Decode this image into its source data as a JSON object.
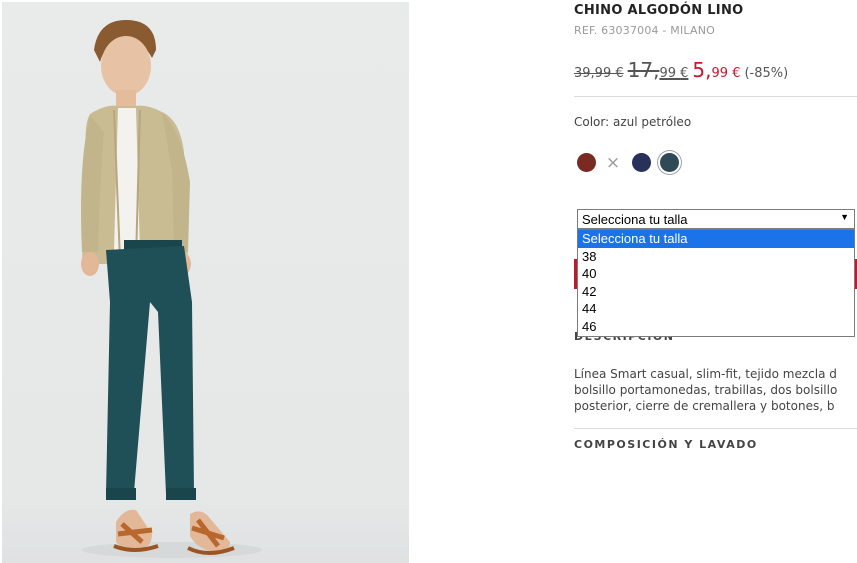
{
  "product": {
    "title": "CHINO ALGODÓN LINO",
    "ref": "REF. 63037004 - MILANO",
    "price_original": "39,99 €",
    "price_mid_int": "17,",
    "price_mid_dec": "99",
    "price_mid_cur": "€",
    "price_new_int": "5,",
    "price_new_dec": "99",
    "price_new_cur": "€",
    "discount": "(-85%)",
    "color_label": "Color: azul petróleo"
  },
  "swatches": [
    {
      "name": "granate",
      "color": "#7a2a22"
    },
    {
      "name": "unavailable",
      "symbol": "×"
    },
    {
      "name": "azul-marino",
      "color": "#27315a"
    },
    {
      "name": "azul-petroleo",
      "color": "#2f4a56",
      "selected": true
    }
  ],
  "size_select": {
    "value": "Selecciona tu talla",
    "options": [
      "Selecciona tu talla",
      "38",
      "40",
      "42",
      "44",
      "46"
    ],
    "highlighted": 0
  },
  "description": {
    "heading": "DESCRIPCIÓN",
    "lines": [
      "Línea Smart casual, slim-fit, tejido mezcla d",
      "bolsillo portamonedas, trabillas, dos bolsillo",
      "posterior, cierre de cremallera y botones, b"
    ]
  },
  "composition_heading": "COMPOSICIÓN Y LAVADO",
  "colors": {
    "sale_red": "#c5172b",
    "highlight_blue": "#1a73e8",
    "pants_teal": "#1f4f57",
    "cardigan_beige": "#c9bc93"
  }
}
